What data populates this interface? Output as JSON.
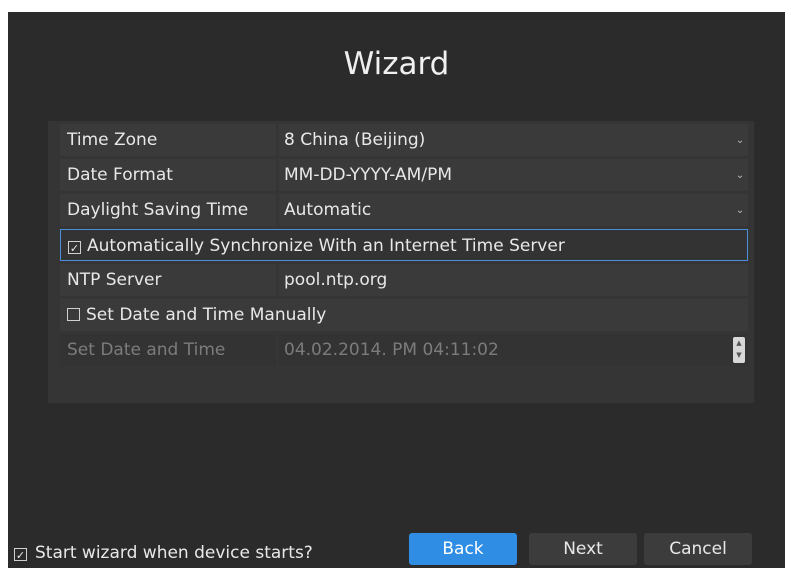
{
  "wizard": {
    "title": "Wizard"
  },
  "settings": {
    "time_zone": {
      "label": "Time Zone",
      "value": "8 China (Beijing)",
      "caret": "⌄"
    },
    "date_format": {
      "label": "Date Format",
      "value": "MM-DD-YYYY-AM/PM",
      "caret": "⌄"
    },
    "dst": {
      "label": "Daylight Saving Time",
      "value": "Automatic",
      "caret": "⌄"
    },
    "auto_sync": {
      "checked": true,
      "check_mark": "✓",
      "label": "Automatically Synchronize With an Internet Time Server"
    },
    "ntp": {
      "label": "NTP Server",
      "value": "pool.ntp.org"
    },
    "manual": {
      "checked": false,
      "check_mark": "",
      "label": "Set Date and Time Manually"
    },
    "set_datetime": {
      "label": "Set Date and Time",
      "value": "04.02.2014. PM 04:11:02",
      "spin_up": "▲",
      "spin_down": "▼"
    }
  },
  "footer": {
    "start_wizard": {
      "checked": true,
      "check_mark": "✓",
      "label": "Start wizard when device starts?"
    },
    "back_label": "Back",
    "next_label": "Next",
    "cancel_label": "Cancel"
  },
  "colors": {
    "accent": "#2f8de4",
    "background": "#2b2b2b",
    "row": "#3a3a3a",
    "selection_border": "#4a90d9"
  }
}
